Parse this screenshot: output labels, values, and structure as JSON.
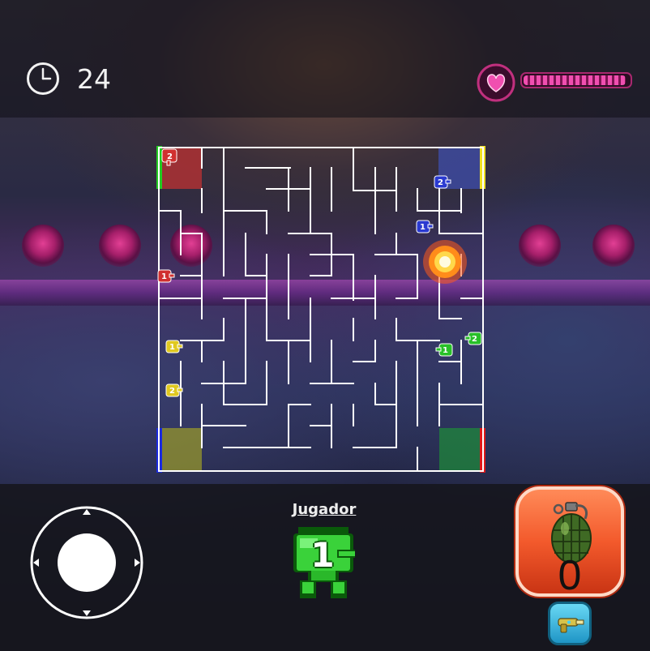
{
  "hud": {
    "timer_value": "24",
    "clock_icon": "clock-icon",
    "health_icon": "heart-icon",
    "health_level": 0.97,
    "health_color": "#f04fb0"
  },
  "maze": {
    "zones": [
      {
        "color": "#c43232",
        "accent": "#22cc22",
        "corner": "top-left"
      },
      {
        "color": "#3f4fb0",
        "accent": "#f0e020",
        "corner": "top-right"
      },
      {
        "color": "#9a9a2a",
        "accent": "#1a2ae0",
        "corner": "bottom-left"
      },
      {
        "color": "#1f8a3a",
        "accent": "#e01818",
        "corner": "bottom-right"
      }
    ],
    "tanks": [
      {
        "team": "red",
        "number": "2",
        "color": "#d03030"
      },
      {
        "team": "red",
        "number": "1",
        "color": "#d03030"
      },
      {
        "team": "blue",
        "number": "2",
        "color": "#2a3ad0"
      },
      {
        "team": "blue",
        "number": "1",
        "color": "#2a3ad0"
      },
      {
        "team": "yellow",
        "number": "1",
        "color": "#e0c820"
      },
      {
        "team": "yellow",
        "number": "2",
        "color": "#e0c820"
      },
      {
        "team": "green",
        "number": "2",
        "color": "#28c028"
      },
      {
        "team": "green",
        "number": "1",
        "color": "#28c028"
      }
    ],
    "explosion": "explosion-icon"
  },
  "controls": {
    "joystick_icon": "joystick-icon",
    "player_label": "Jugador",
    "player_number": "1",
    "player_icon": "green-tank-icon",
    "grenade_count": "0",
    "grenade_icon": "grenade-icon",
    "weapon_icon": "ray-gun-icon"
  }
}
